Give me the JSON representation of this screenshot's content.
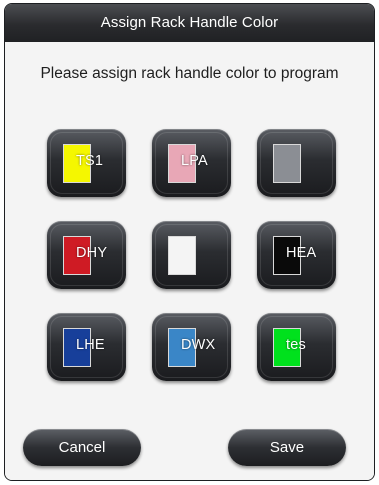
{
  "dialog": {
    "title": "Assign Rack Handle Color",
    "prompt": "Please assign rack handle color to program"
  },
  "colors": [
    {
      "code": "TS1",
      "color": "#f5f700"
    },
    {
      "code": "LPA",
      "color": "#e8a7b6"
    },
    {
      "code": "",
      "color": "#8b8e94"
    },
    {
      "code": "DHY",
      "color": "#cf1b24"
    },
    {
      "code": "",
      "color": "#f4f4f4"
    },
    {
      "code": "HEA",
      "color": "#0a0a0a"
    },
    {
      "code": "LHE",
      "color": "#173f9a"
    },
    {
      "code": "DWX",
      "color": "#3a86c7"
    },
    {
      "code": "tes",
      "color": "#00e11d"
    }
  ],
  "buttons": {
    "cancel_label": "Cancel",
    "save_label": "Save"
  },
  "theme": {
    "title_bar": "#2a2b2e",
    "tile": "#2b2d31",
    "dialog_bg": "#f4f4f4"
  }
}
